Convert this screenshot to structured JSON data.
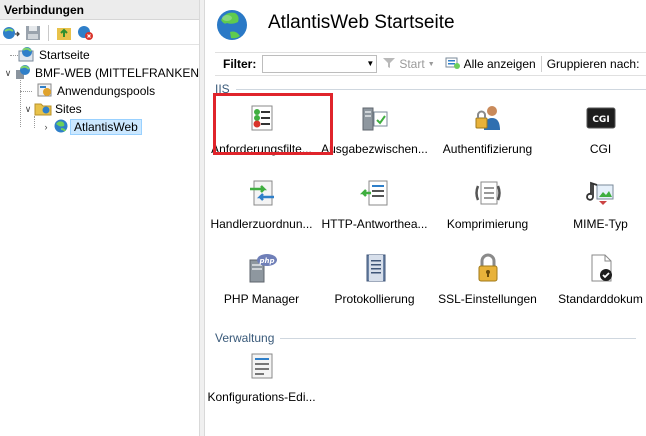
{
  "connections": {
    "header": "Verbindungen",
    "toolbar_icons": [
      "connect-icon",
      "save-icon",
      "up-icon",
      "delete-connection-icon"
    ],
    "tree": [
      {
        "label": "Startseite",
        "icon": "start-page-icon",
        "level": 0
      },
      {
        "label": "BMF-WEB (MITTELFRANKEN\\",
        "icon": "server-icon",
        "level": 0,
        "expanded": true
      },
      {
        "label": "Anwendungspools",
        "icon": "app-pools-icon",
        "level": 1
      },
      {
        "label": "Sites",
        "icon": "folder-icon",
        "level": 1,
        "expanded": true
      },
      {
        "label": "AtlantisWeb",
        "icon": "globe-icon",
        "level": 2,
        "selected": true
      }
    ]
  },
  "page": {
    "title": "AtlantisWeb Startseite"
  },
  "filterbar": {
    "filter_label": "Filter:",
    "filter_value": "",
    "start_label": "Start",
    "show_all_label": "Alle anzeigen",
    "group_by_label": "Gruppieren nach:"
  },
  "sections": {
    "iis": "IIS",
    "management": "Verwaltung"
  },
  "features": [
    {
      "label": "Anforderungsfilte...",
      "icon": "request-filtering-icon",
      "highlighted": true
    },
    {
      "label": "Ausgabezwischen...",
      "icon": "output-caching-icon"
    },
    {
      "label": "Authentifizierung",
      "icon": "authentication-icon"
    },
    {
      "label": "CGI",
      "icon": "cgi-icon"
    },
    {
      "label": "Handlerzuordnun...",
      "icon": "handler-mappings-icon"
    },
    {
      "label": "HTTP-Antworthea...",
      "icon": "http-response-headers-icon"
    },
    {
      "label": "Komprimierung",
      "icon": "compression-icon"
    },
    {
      "label": "MIME-Typ",
      "icon": "mime-types-icon"
    },
    {
      "label": "PHP Manager",
      "icon": "php-manager-icon"
    },
    {
      "label": "Protokollierung",
      "icon": "logging-icon"
    },
    {
      "label": "SSL-Einstellungen",
      "icon": "ssl-settings-icon"
    },
    {
      "label": "Standarddokum",
      "icon": "default-document-icon"
    }
  ],
  "management_features": [
    {
      "label": "Konfigurations-Edi...",
      "icon": "configuration-editor-icon"
    }
  ],
  "colors": {
    "highlight": "#e0242b",
    "selection": "#cce8ff",
    "section_text": "#3a5a7a"
  }
}
